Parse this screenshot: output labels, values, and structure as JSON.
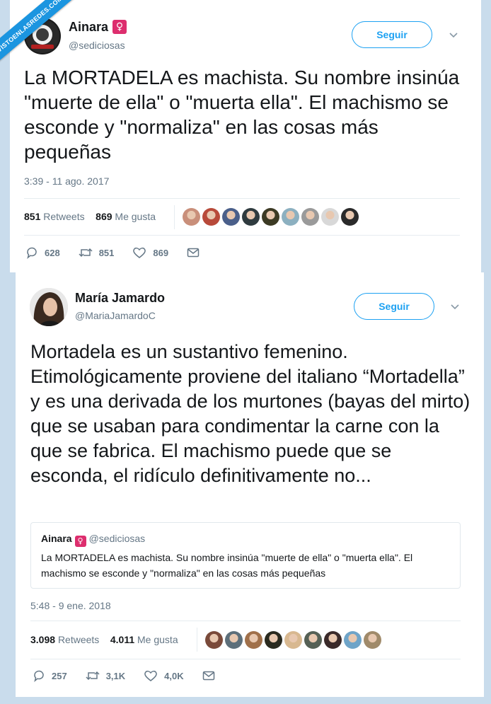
{
  "watermark": "VISTOENLASREDES.COM",
  "tweet1": {
    "name": "Ainara",
    "gender_badge": "♀",
    "handle": "@sediciosas",
    "follow_label": "Seguir",
    "text": "La MORTADELA es machista. Su nombre insinúa \"muerte de ella\" o \"muerta ella\". El machismo se esconde y \"normaliza\" en las cosas más pequeñas",
    "time": "3:39 - 11 ago. 2017",
    "retweets_count": "851",
    "retweets_label": "Retweets",
    "likes_count": "869",
    "likes_label": "Me gusta",
    "actions": {
      "replies": "628",
      "retweets": "851",
      "likes": "869"
    },
    "face_colors": [
      "#c98f7a",
      "#b84a3a",
      "#4a5f8a",
      "#2f3b3f",
      "#3c3a24",
      "#8cb0c0",
      "#9a9a9a",
      "#d8d8d8",
      "#2a2a2a"
    ]
  },
  "tweet2": {
    "name": "María Jamardo",
    "handle": "@MariaJamardoC",
    "follow_label": "Seguir",
    "text": "Mortadela es un sustantivo femenino. Etimológicamente proviene del italiano “Mortadella” y es una derivada de los murtones (bayas del mirto) que se usaban para condimentar la carne con la que se fabrica. El machismo puede que se esconda, el ridículo definitivamente no...",
    "quote": {
      "name": "Ainara",
      "gender_badge": "♀",
      "handle": "@sediciosas",
      "text": "La MORTADELA es machista. Su nombre insinúa \"muerte de ella\" o \"muerta ella\". El machismo se esconde y \"normaliza\" en las cosas más pequeñas"
    },
    "time": "5:48 - 9 ene. 2018",
    "retweets_count": "3.098",
    "retweets_label": "Retweets",
    "likes_count": "4.011",
    "likes_label": "Me gusta",
    "actions": {
      "replies": "257",
      "retweets": "3,1K",
      "likes": "4,0K"
    },
    "face_colors": [
      "#7a4a3a",
      "#5d6f7a",
      "#a0704a",
      "#2a2a1f",
      "#d8b890",
      "#556055",
      "#3a2a2a",
      "#6fa4c8",
      "#a08a6a"
    ]
  },
  "colors": {
    "accent": "#1da1f2",
    "muted": "#657786",
    "badge": "#dd2e6e",
    "background": "#c9dcec"
  }
}
